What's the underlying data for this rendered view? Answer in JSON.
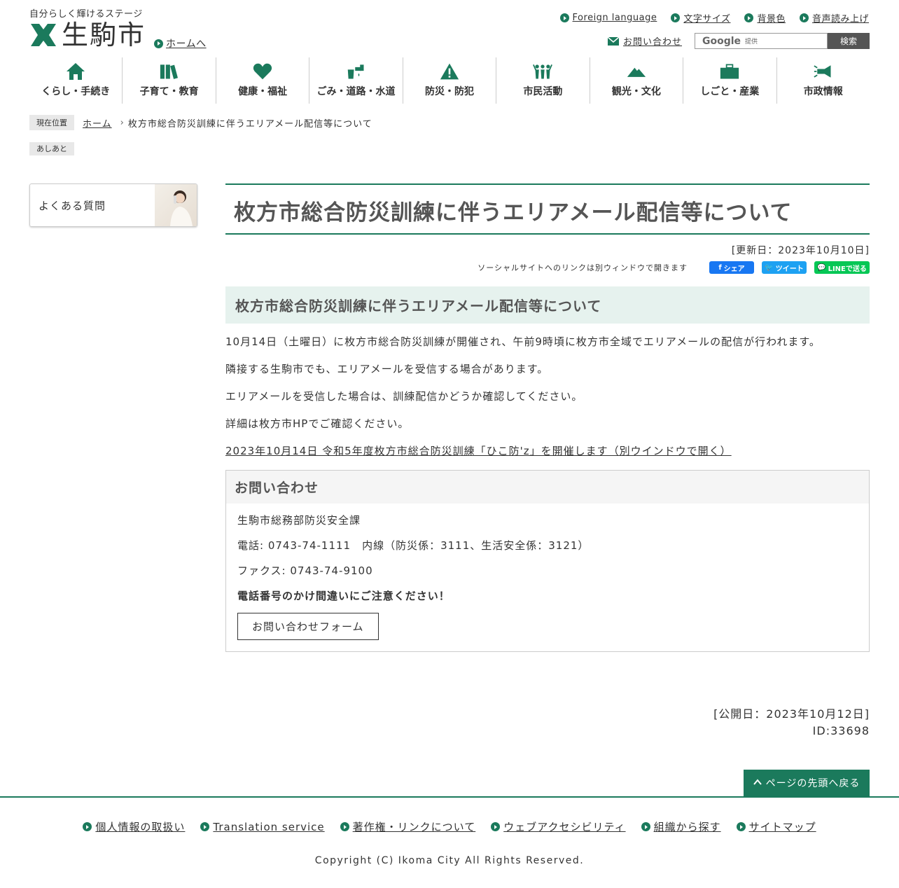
{
  "header": {
    "tagline": "自分らしく輝けるステージ",
    "logo_text": "生駒市",
    "home_link": "ホームへ",
    "top_links": [
      "Foreign language",
      "文字サイズ",
      "背景色",
      "音声読み上げ"
    ],
    "inquiry": "お問い合わせ",
    "search": {
      "google": "Google",
      "provided": "提供",
      "button": "検索"
    }
  },
  "nav": [
    {
      "label": "くらし・手続き",
      "icon": "house-icon"
    },
    {
      "label": "子育て・教育",
      "icon": "books-icon"
    },
    {
      "label": "健康・福祉",
      "icon": "heart-icon"
    },
    {
      "label": "ごみ・道路・水道",
      "icon": "faucet-icon"
    },
    {
      "label": "防災・防犯",
      "icon": "warning-icon"
    },
    {
      "label": "市民活動",
      "icon": "people-icon"
    },
    {
      "label": "観光・文化",
      "icon": "mountain-icon"
    },
    {
      "label": "しごと・産業",
      "icon": "briefcase-icon"
    },
    {
      "label": "市政情報",
      "icon": "megaphone-icon"
    }
  ],
  "breadcrumb": {
    "label": "現在位置",
    "home": "ホーム",
    "current": "枚方市総合防災訓練に伴うエリアメール配信等について",
    "ashiato": "あしあと"
  },
  "sidebar": {
    "faq": "よくある質問"
  },
  "article": {
    "title": "枚方市総合防災訓練に伴うエリアメール配信等について",
    "updated": "[更新日：2023年10月10日]",
    "social_note": "ソーシャルサイトへのリンクは別ウィンドウで開きます",
    "share_fb": "シェア",
    "share_tw": "ツイート",
    "share_line": "LINEで送る",
    "heading": "枚方市総合防災訓練に伴うエリアメール配信等について",
    "paragraphs": [
      "10月14日（土曜日）に枚方市総合防災訓練が開催され、午前9時頃に枚方市全域でエリアメールの配信が行われます。",
      "隣接する生駒市でも、エリアメールを受信する場合があります。",
      "エリアメールを受信した場合は、訓練配信かどうか確認してください。",
      "詳細は枚方市HPでご確認ください。"
    ],
    "link": "2023年10月14日 令和5年度枚方市総合防災訓練「ひこ防'z」を開催します（別ウインドウで開く）"
  },
  "contact": {
    "title": "お問い合わせ",
    "dept": "生駒市総務部防災安全課",
    "phone": "電話: 0743-74-1111　内線（防災係：3111、生活安全係：3121）",
    "fax": "ファクス: 0743-74-9100",
    "warning": "電話番号のかけ間違いにご注意ください！",
    "form_button": "お問い合わせフォーム"
  },
  "page_info": {
    "published": "[公開日：2023年10月12日]",
    "id": "ID:33698"
  },
  "pagetop": "ページの先頭へ戻る",
  "footer": {
    "links": [
      "個人情報の取扱い",
      "Translation service",
      "著作権・リンクについて",
      "ウェブアクセシビリティ",
      "組織から探す",
      "サイトマップ"
    ],
    "copyright": "Copyright (C) Ikoma City All Rights Reserved."
  },
  "colors": {
    "accent": "#1b7a5c",
    "heading_bg": "#e6f2ee",
    "fb": "#1877f2",
    "tw": "#1da1f2",
    "line": "#06c755"
  }
}
